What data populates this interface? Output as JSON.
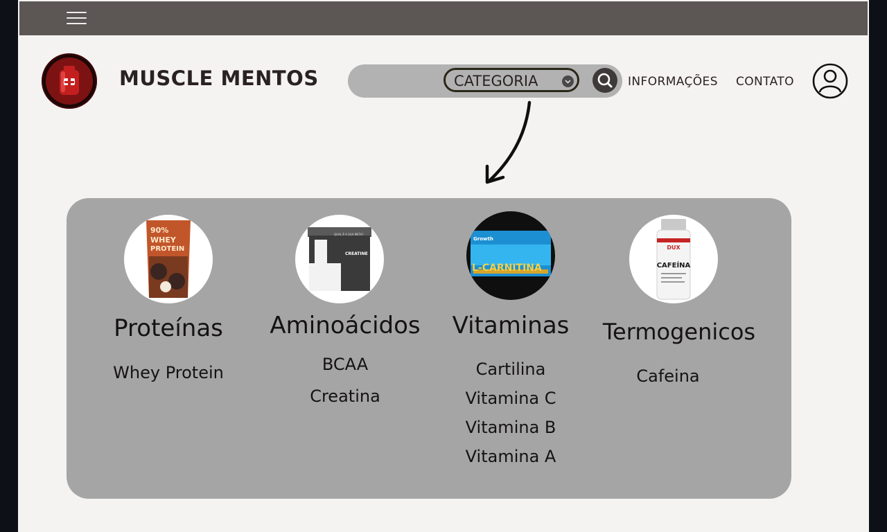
{
  "header": {
    "brand": "MUSCLE MENTOS",
    "category_label": "CATEGORIA",
    "nav": [
      {
        "label": "INFORMAÇÕES"
      },
      {
        "label": "CONTATO"
      }
    ]
  },
  "colors": {
    "topbar": "#5c5655",
    "page_bg": "#f4f3f2",
    "panel_bg": "#a6a5a5",
    "search_bg": "#b3b2b2",
    "logo_red": "#7a1414",
    "text_dark": "#141212"
  },
  "icons": {
    "menu": "hamburger-icon",
    "search": "search-icon",
    "user": "user-account-icon",
    "logo": "supplement-jar-icon",
    "dropdown": "chevron-down-icon",
    "arrow": "curved-arrow-icon"
  },
  "categories": [
    {
      "title": "Proteínas",
      "product_text": [
        "90%",
        "WHEY",
        "PROTEIN"
      ],
      "items": [
        "Whey Protein"
      ]
    },
    {
      "title": "Aminoácidos",
      "product_text": [
        "QUAL É A SUA META?",
        "CREATINE"
      ],
      "items": [
        "BCAA",
        "Creatina"
      ]
    },
    {
      "title": "Vitaminas",
      "product_text": [
        "Growth",
        "L-CARNITINA"
      ],
      "items": [
        "Cartilina",
        "Vitamina C",
        "Vitamina B",
        "Vitamina A"
      ]
    },
    {
      "title": "Termogenicos",
      "product_text": [
        "DUX",
        "CAFEÍNA"
      ],
      "items": [
        "Cafeina"
      ]
    }
  ]
}
